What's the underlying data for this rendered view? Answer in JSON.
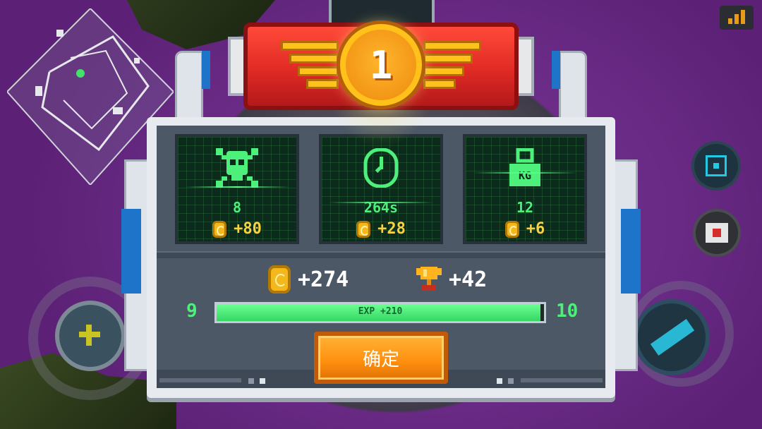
{
  "rank": {
    "number": "1"
  },
  "stats": [
    {
      "icon": "skull-icon",
      "value": "8",
      "reward": "+80"
    },
    {
      "icon": "clock-icon",
      "value": "264s",
      "reward": "+28"
    },
    {
      "icon": "weight-icon",
      "value": "12",
      "reward": "+6",
      "icon_label": "KG"
    }
  ],
  "totals": {
    "coins": "+274",
    "trophies": "+42"
  },
  "level": {
    "current": "9",
    "next": "10",
    "exp_label": "EXP +210",
    "exp_fill": 0.99
  },
  "confirm_label": "确定",
  "colors": {
    "accent_green": "#4cf07a",
    "banner_red": "#e02a24",
    "coin_gold": "#f4b81c",
    "button_orange": "#ff8f0f"
  }
}
